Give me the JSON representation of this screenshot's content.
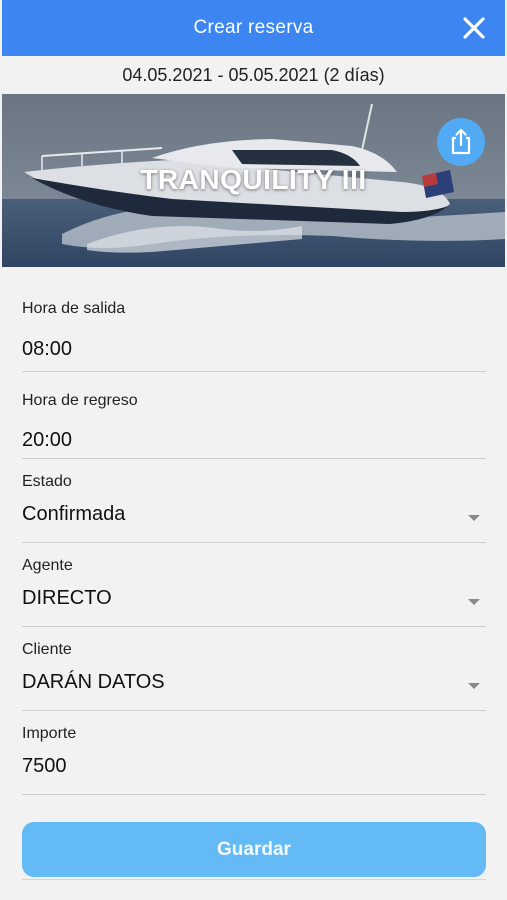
{
  "header": {
    "title": "Crear reserva",
    "close_icon": "close-icon",
    "color": "#3d85f0"
  },
  "dates": {
    "range": "04.05.2021 - 05.05.2021 (2 días)"
  },
  "boat": {
    "name": "TRANQUILITY III",
    "share_icon": "share-icon"
  },
  "form": {
    "departure": {
      "label": "Hora de salida",
      "value": "08:00"
    },
    "return": {
      "label": "Hora de regreso",
      "value": "20:00"
    },
    "status": {
      "label": "Estado",
      "value": "Confirmada"
    },
    "agent": {
      "label": "Agente",
      "value": "DIRECTO"
    },
    "client": {
      "label": "Cliente",
      "value": "DARÁN DATOS"
    },
    "amount": {
      "label": "Importe",
      "value": "7500"
    }
  },
  "actions": {
    "save_label": "Guardar",
    "save_color": "#64baf5"
  }
}
